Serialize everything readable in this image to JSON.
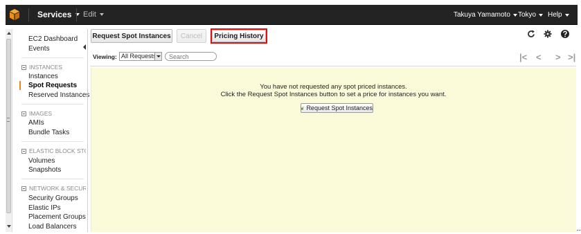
{
  "topbar": {
    "services_label": "Services",
    "edit_label": "Edit",
    "user_label": "Takuya Yamamoto",
    "region_label": "Tokyo",
    "help_label": "Help",
    "logo_color": "#f29111"
  },
  "sidebar": {
    "dashboard": "EC2 Dashboard",
    "events": "Events",
    "sections": {
      "instances": "INSTANCES",
      "images": "IMAGES",
      "ebs": "ELASTIC BLOCK STORE",
      "network": "NETWORK & SECURITY"
    },
    "items": {
      "instances": "Instances",
      "spot_requests": "Spot Requests",
      "reserved_instances": "Reserved Instances",
      "amis": "AMIs",
      "bundle_tasks": "Bundle Tasks",
      "volumes": "Volumes",
      "snapshots": "Snapshots",
      "security_groups": "Security Groups",
      "elastic_ips": "Elastic IPs",
      "placement_groups": "Placement Groups",
      "load_balancers": "Load Balancers"
    },
    "active_item": "Spot Requests",
    "accent_color": "#e48a11"
  },
  "toolbar": {
    "request_label": "Request Spot Instances",
    "cancel_label": "Cancel",
    "pricing_label": "Pricing History",
    "highlight_color": "#e01010"
  },
  "filter": {
    "viewing_label": "Viewing:",
    "select_value": "All Requests",
    "search_placeholder": "Search"
  },
  "content": {
    "empty_line1": "You have not requested any spot priced instances.",
    "empty_line2": "Click the Request Spot Instances button to set a price for instances you want.",
    "button_label": "Request Spot Instances",
    "panel_color": "#fbfbd9"
  }
}
